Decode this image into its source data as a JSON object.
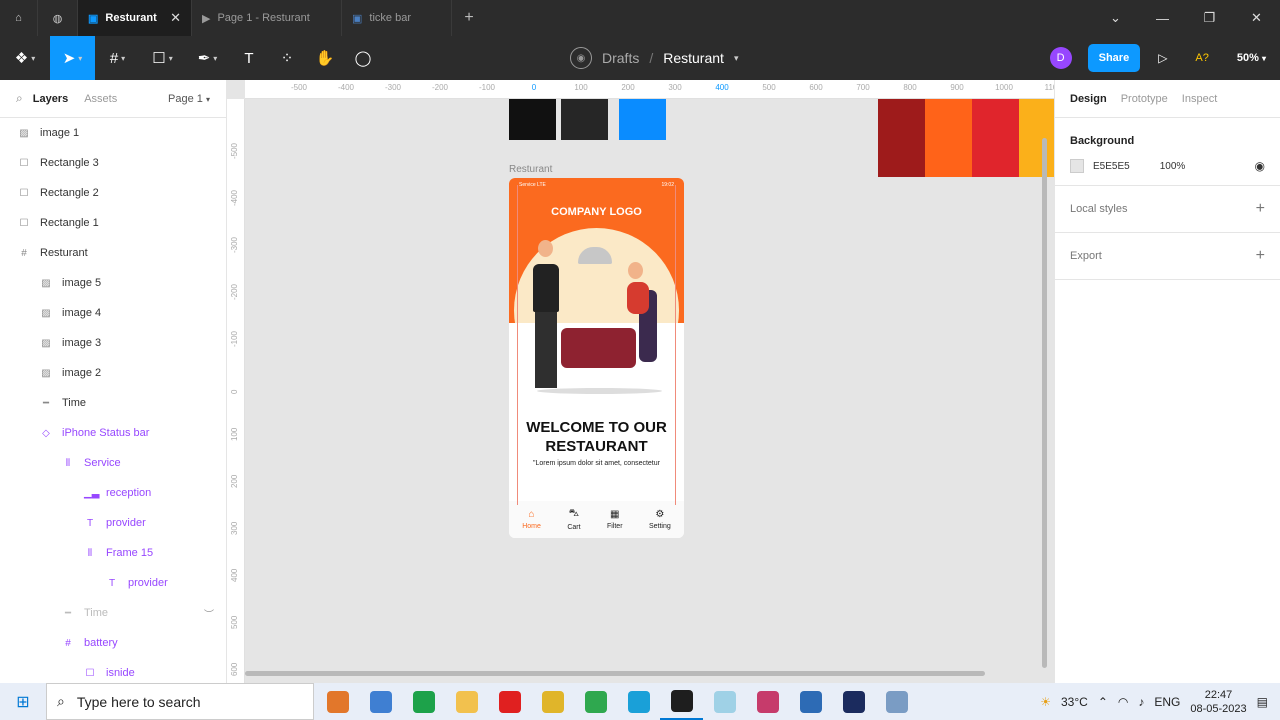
{
  "window": {
    "tabs": [
      {
        "label": "Resturant",
        "active": true
      },
      {
        "label": "Page 1 - Resturant",
        "active": false
      },
      {
        "label": "ticke bar",
        "active": false
      }
    ]
  },
  "toolbar": {
    "breadcrumb_drafts": "Drafts",
    "breadcrumb_sep": "/",
    "file_name": "Resturant",
    "avatar_initial": "D",
    "share_label": "Share",
    "a2_label": "A?",
    "zoom_label": "50%"
  },
  "left_panel": {
    "tab_layers": "Layers",
    "tab_assets": "Assets",
    "page_label": "Page 1",
    "layers": [
      {
        "name": "image 1",
        "icon": "image-icon",
        "indent": 0,
        "style": "normal"
      },
      {
        "name": "Rectangle 3",
        "icon": "rect-icon",
        "indent": 0,
        "style": "normal"
      },
      {
        "name": "Rectangle 2",
        "icon": "rect-icon",
        "indent": 0,
        "style": "normal"
      },
      {
        "name": "Rectangle 1",
        "icon": "rect-icon",
        "indent": 0,
        "style": "normal"
      },
      {
        "name": "Resturant",
        "icon": "frame-icon",
        "indent": 0,
        "style": "normal"
      },
      {
        "name": "image 5",
        "icon": "image-icon",
        "indent": 1,
        "style": "normal"
      },
      {
        "name": "image 4",
        "icon": "image-icon",
        "indent": 1,
        "style": "normal"
      },
      {
        "name": "image 3",
        "icon": "image-icon",
        "indent": 1,
        "style": "normal"
      },
      {
        "name": "image 2",
        "icon": "image-icon",
        "indent": 1,
        "style": "normal"
      },
      {
        "name": "Time",
        "icon": "line-icon",
        "indent": 1,
        "style": "normal"
      },
      {
        "name": "iPhone Status bar",
        "icon": "instance-icon",
        "indent": 1,
        "style": "comp"
      },
      {
        "name": "Service",
        "icon": "autolayout-icon",
        "indent": 2,
        "style": "comp"
      },
      {
        "name": "reception",
        "icon": "signal-icon",
        "indent": 3,
        "style": "comp"
      },
      {
        "name": "provider",
        "icon": "text-icon",
        "indent": 3,
        "style": "comp"
      },
      {
        "name": "Frame 15",
        "icon": "autolayout-icon",
        "indent": 3,
        "style": "comp"
      },
      {
        "name": "provider",
        "icon": "text-icon",
        "indent": 4,
        "style": "comp"
      },
      {
        "name": "Time",
        "icon": "line-icon",
        "indent": 2,
        "style": "dim"
      },
      {
        "name": "battery",
        "icon": "frame-icon",
        "indent": 2,
        "style": "comp"
      },
      {
        "name": "isnide",
        "icon": "rect-icon",
        "indent": 3,
        "style": "comp"
      }
    ]
  },
  "canvas": {
    "ruler_x": [
      "-500",
      "-400",
      "-300",
      "-200",
      "-100",
      "0",
      "100",
      "200",
      "300",
      "400",
      "500",
      "600",
      "700",
      "800",
      "900",
      "1000",
      "110"
    ],
    "ruler_y": [
      "-500",
      "-400",
      "-300",
      "-200",
      "-100",
      "0",
      "100",
      "200",
      "300",
      "400",
      "500",
      "600"
    ],
    "frame_label": "Resturant",
    "swatches": [
      "#111111",
      "#262626",
      "#0a8cff"
    ],
    "palette": [
      "#9e1b1b",
      "#ff6319",
      "#e0252c",
      "#fbb01a"
    ]
  },
  "phone": {
    "status_left": "Service LTE",
    "status_right": "19:02",
    "logo": "COMPANY LOGO",
    "welcome_line1": "WELCOME TO OUR",
    "welcome_line2": "RESTAURANT",
    "lorem": "\"Lorem ipsum dolor sit amet, consectetur",
    "nav": [
      {
        "label": "Home",
        "icon": "home-icon",
        "active": true
      },
      {
        "label": "Cart",
        "icon": "cart-icon",
        "active": false
      },
      {
        "label": "Filter",
        "icon": "filter-icon",
        "active": false
      },
      {
        "label": "Setting",
        "icon": "gear-icon",
        "active": false
      }
    ]
  },
  "right_panel": {
    "tab_design": "Design",
    "tab_prototype": "Prototype",
    "tab_inspect": "Inspect",
    "background_title": "Background",
    "bg_hex": "E5E5E5",
    "bg_opacity": "100%",
    "local_styles": "Local styles",
    "export": "Export"
  },
  "taskbar": {
    "search_placeholder": "Type here to search",
    "weather": "33°C",
    "lang": "ENG",
    "time": "22:47",
    "date": "08-05-2023",
    "apps": [
      "#e2772b",
      "#3f7fd2",
      "#1da24a",
      "#f2c14e",
      "#e02020",
      "#e0b52a",
      "#2fa84f",
      "#1aa0d8",
      "#1e1e1e",
      "#9fd1e6",
      "#c63b6b",
      "#2d6bb5",
      "#1b2b5e",
      "#7a9cc4"
    ]
  }
}
